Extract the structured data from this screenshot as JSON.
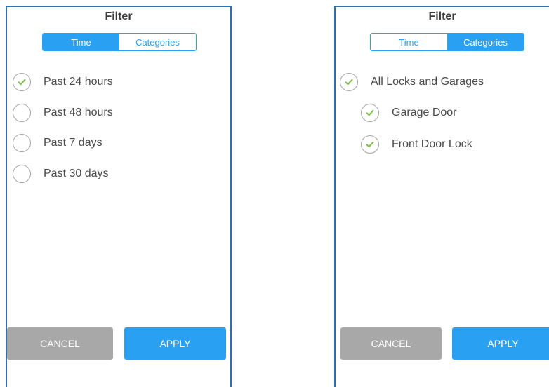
{
  "panels": [
    {
      "title": "Filter",
      "tabs": [
        {
          "label": "Time",
          "active": true
        },
        {
          "label": "Categories",
          "active": false
        }
      ],
      "options": [
        {
          "label": "Past 24 hours",
          "checked": true
        },
        {
          "label": "Past 48 hours",
          "checked": false
        },
        {
          "label": "Past 7 days",
          "checked": false
        },
        {
          "label": "Past 30 days",
          "checked": false
        }
      ],
      "buttons": {
        "cancel": "CANCEL",
        "apply": "APPLY"
      }
    },
    {
      "title": "Filter",
      "tabs": [
        {
          "label": "Time",
          "active": false
        },
        {
          "label": "Categories",
          "active": true
        }
      ],
      "options": [
        {
          "label": "All Locks and Garages",
          "checked": true,
          "level": 0
        },
        {
          "label": "Garage Door",
          "checked": true,
          "level": 1
        },
        {
          "label": "Front Door Lock",
          "checked": true,
          "level": 1
        }
      ],
      "buttons": {
        "cancel": "CANCEL",
        "apply": "APPLY"
      }
    }
  ],
  "colors": {
    "accent": "#2aa0f2",
    "frame": "#2f6fb1",
    "check": "#7cc142",
    "cancel_bg": "#a8a8a8"
  },
  "icons": {
    "check": "checkmark-icon"
  }
}
